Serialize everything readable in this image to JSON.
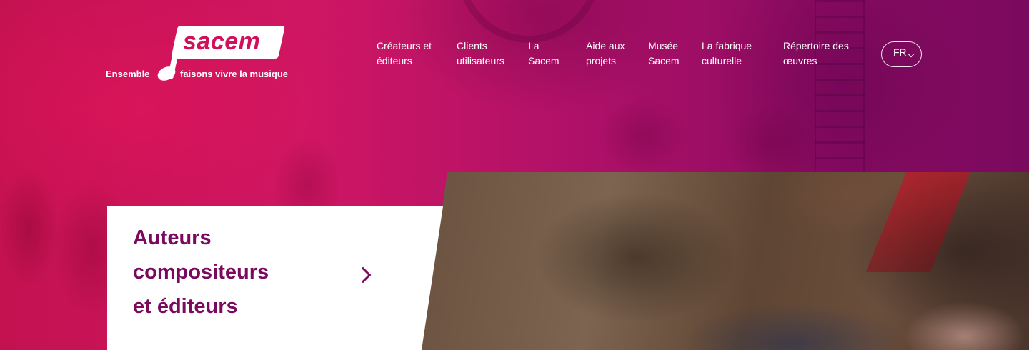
{
  "logo": {
    "wordmark": "sacem",
    "tagline_left": "Ensemble",
    "tagline_right": "faisons vivre la musique"
  },
  "nav": {
    "items": [
      {
        "line1": "Créateurs et",
        "line2": "éditeurs"
      },
      {
        "line1": "Clients",
        "line2": "utilisateurs"
      },
      {
        "line1": "La",
        "line2": "Sacem"
      },
      {
        "line1": "Aide aux",
        "line2": "projets"
      },
      {
        "line1": "Musée",
        "line2": "Sacem"
      },
      {
        "line1": "La fabrique",
        "line2": "culturelle"
      },
      {
        "line1": "Répertoire des",
        "line2": "œuvres"
      }
    ]
  },
  "language": {
    "selected": "FR"
  },
  "card": {
    "title_lines": [
      "Auteurs",
      "compositeurs",
      "et éditeurs"
    ]
  },
  "colors": {
    "brand": "#d0115a",
    "card_text": "#7b0a5f",
    "hero_left": "#c41250",
    "hero_right": "#7a0a5e"
  },
  "icons": {
    "note": "music-note-icon",
    "language_chevron": "chevron-down-icon",
    "card_chevron": "chevron-right-icon"
  }
}
